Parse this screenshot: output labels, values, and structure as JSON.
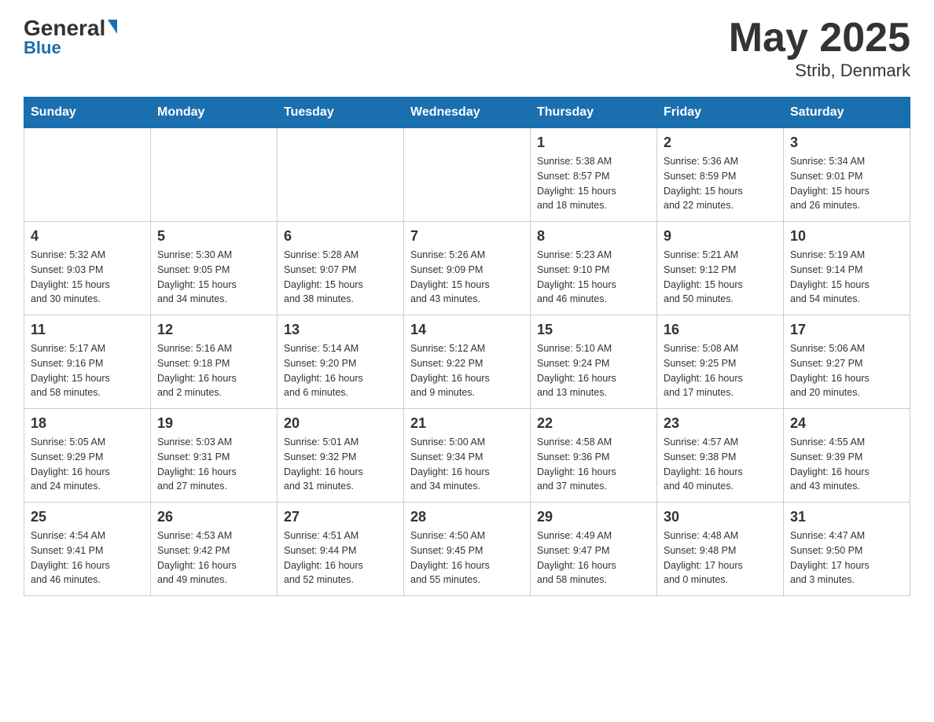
{
  "header": {
    "logo_general": "General",
    "logo_blue": "Blue",
    "title": "May 2025",
    "subtitle": "Strib, Denmark"
  },
  "days_of_week": [
    "Sunday",
    "Monday",
    "Tuesday",
    "Wednesday",
    "Thursday",
    "Friday",
    "Saturday"
  ],
  "weeks": [
    [
      {
        "day": "",
        "info": ""
      },
      {
        "day": "",
        "info": ""
      },
      {
        "day": "",
        "info": ""
      },
      {
        "day": "",
        "info": ""
      },
      {
        "day": "1",
        "info": "Sunrise: 5:38 AM\nSunset: 8:57 PM\nDaylight: 15 hours\nand 18 minutes."
      },
      {
        "day": "2",
        "info": "Sunrise: 5:36 AM\nSunset: 8:59 PM\nDaylight: 15 hours\nand 22 minutes."
      },
      {
        "day": "3",
        "info": "Sunrise: 5:34 AM\nSunset: 9:01 PM\nDaylight: 15 hours\nand 26 minutes."
      }
    ],
    [
      {
        "day": "4",
        "info": "Sunrise: 5:32 AM\nSunset: 9:03 PM\nDaylight: 15 hours\nand 30 minutes."
      },
      {
        "day": "5",
        "info": "Sunrise: 5:30 AM\nSunset: 9:05 PM\nDaylight: 15 hours\nand 34 minutes."
      },
      {
        "day": "6",
        "info": "Sunrise: 5:28 AM\nSunset: 9:07 PM\nDaylight: 15 hours\nand 38 minutes."
      },
      {
        "day": "7",
        "info": "Sunrise: 5:26 AM\nSunset: 9:09 PM\nDaylight: 15 hours\nand 43 minutes."
      },
      {
        "day": "8",
        "info": "Sunrise: 5:23 AM\nSunset: 9:10 PM\nDaylight: 15 hours\nand 46 minutes."
      },
      {
        "day": "9",
        "info": "Sunrise: 5:21 AM\nSunset: 9:12 PM\nDaylight: 15 hours\nand 50 minutes."
      },
      {
        "day": "10",
        "info": "Sunrise: 5:19 AM\nSunset: 9:14 PM\nDaylight: 15 hours\nand 54 minutes."
      }
    ],
    [
      {
        "day": "11",
        "info": "Sunrise: 5:17 AM\nSunset: 9:16 PM\nDaylight: 15 hours\nand 58 minutes."
      },
      {
        "day": "12",
        "info": "Sunrise: 5:16 AM\nSunset: 9:18 PM\nDaylight: 16 hours\nand 2 minutes."
      },
      {
        "day": "13",
        "info": "Sunrise: 5:14 AM\nSunset: 9:20 PM\nDaylight: 16 hours\nand 6 minutes."
      },
      {
        "day": "14",
        "info": "Sunrise: 5:12 AM\nSunset: 9:22 PM\nDaylight: 16 hours\nand 9 minutes."
      },
      {
        "day": "15",
        "info": "Sunrise: 5:10 AM\nSunset: 9:24 PM\nDaylight: 16 hours\nand 13 minutes."
      },
      {
        "day": "16",
        "info": "Sunrise: 5:08 AM\nSunset: 9:25 PM\nDaylight: 16 hours\nand 17 minutes."
      },
      {
        "day": "17",
        "info": "Sunrise: 5:06 AM\nSunset: 9:27 PM\nDaylight: 16 hours\nand 20 minutes."
      }
    ],
    [
      {
        "day": "18",
        "info": "Sunrise: 5:05 AM\nSunset: 9:29 PM\nDaylight: 16 hours\nand 24 minutes."
      },
      {
        "day": "19",
        "info": "Sunrise: 5:03 AM\nSunset: 9:31 PM\nDaylight: 16 hours\nand 27 minutes."
      },
      {
        "day": "20",
        "info": "Sunrise: 5:01 AM\nSunset: 9:32 PM\nDaylight: 16 hours\nand 31 minutes."
      },
      {
        "day": "21",
        "info": "Sunrise: 5:00 AM\nSunset: 9:34 PM\nDaylight: 16 hours\nand 34 minutes."
      },
      {
        "day": "22",
        "info": "Sunrise: 4:58 AM\nSunset: 9:36 PM\nDaylight: 16 hours\nand 37 minutes."
      },
      {
        "day": "23",
        "info": "Sunrise: 4:57 AM\nSunset: 9:38 PM\nDaylight: 16 hours\nand 40 minutes."
      },
      {
        "day": "24",
        "info": "Sunrise: 4:55 AM\nSunset: 9:39 PM\nDaylight: 16 hours\nand 43 minutes."
      }
    ],
    [
      {
        "day": "25",
        "info": "Sunrise: 4:54 AM\nSunset: 9:41 PM\nDaylight: 16 hours\nand 46 minutes."
      },
      {
        "day": "26",
        "info": "Sunrise: 4:53 AM\nSunset: 9:42 PM\nDaylight: 16 hours\nand 49 minutes."
      },
      {
        "day": "27",
        "info": "Sunrise: 4:51 AM\nSunset: 9:44 PM\nDaylight: 16 hours\nand 52 minutes."
      },
      {
        "day": "28",
        "info": "Sunrise: 4:50 AM\nSunset: 9:45 PM\nDaylight: 16 hours\nand 55 minutes."
      },
      {
        "day": "29",
        "info": "Sunrise: 4:49 AM\nSunset: 9:47 PM\nDaylight: 16 hours\nand 58 minutes."
      },
      {
        "day": "30",
        "info": "Sunrise: 4:48 AM\nSunset: 9:48 PM\nDaylight: 17 hours\nand 0 minutes."
      },
      {
        "day": "31",
        "info": "Sunrise: 4:47 AM\nSunset: 9:50 PM\nDaylight: 17 hours\nand 3 minutes."
      }
    ]
  ]
}
